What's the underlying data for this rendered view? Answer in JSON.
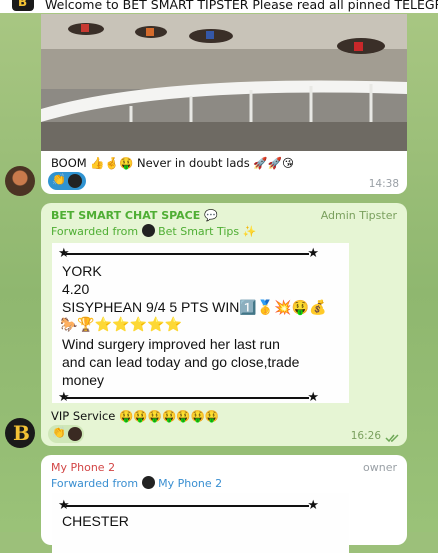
{
  "pinned": {
    "text": "Welcome to  BET SMART TIPSTER  Please read all pinned TELEGRAM post on"
  },
  "msg1": {
    "caption": "BOOM 👍🤞🤑 Never in doubt lads 🚀🚀😘",
    "time": "14:38",
    "image_alt": "greyhound racing track"
  },
  "msg2": {
    "sender": "BET SMART CHAT SPACE 💬",
    "role": "Admin Tipster",
    "forwarded": "Forwarded from",
    "forwarded_source": "Bet Smart Tips ✨",
    "card": {
      "line1": "YORK",
      "line2": "4.20",
      "line3": "SISYPHEAN 9/4 5 PTS WIN1️⃣🥇💥🤑💰",
      "line4": "🐎🏆⭐⭐⭐⭐⭐",
      "line5": "Wind surgery improved her last run",
      "line6": "and can lead today and go close,trade",
      "line7": "money"
    },
    "caption": "VIP Service 🤑🤑🤑🤑🤑🤑🤑",
    "time": "16:26"
  },
  "msg3": {
    "sender": "My Phone 2",
    "role": "owner",
    "forwarded": "Forwarded from",
    "forwarded_source": "My Phone 2",
    "card": {
      "line1": "CHESTER"
    }
  },
  "colors": {
    "bubble_green": "#e6f5d4",
    "accent_green": "#4fae34",
    "name_red": "#d24646",
    "link_blue": "#3a8fd1"
  }
}
